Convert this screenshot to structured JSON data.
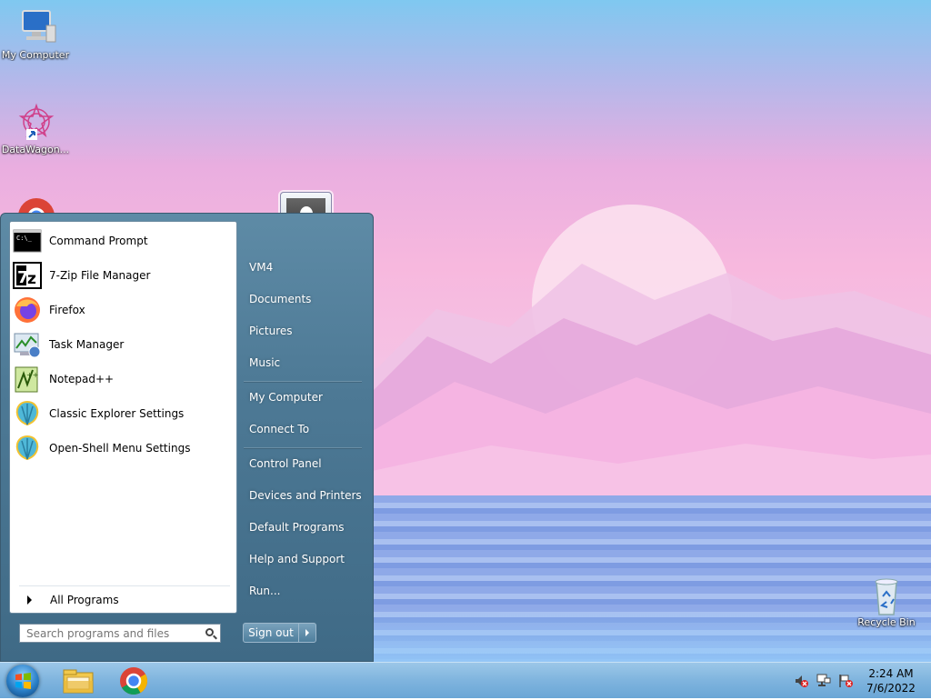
{
  "desktop": {
    "icons": [
      {
        "label": "My Computer",
        "icon": "monitor-icon"
      },
      {
        "label": "DataWagon...",
        "icon": "datawagon-icon"
      },
      {
        "label": "Recycle Bin",
        "icon": "recycle-bin-icon"
      }
    ]
  },
  "start_menu": {
    "programs": [
      {
        "label": "Command Prompt",
        "icon": "command-prompt-icon"
      },
      {
        "label": "7-Zip File Manager",
        "icon": "7zip-icon"
      },
      {
        "label": "Firefox",
        "icon": "firefox-icon"
      },
      {
        "label": "Task Manager",
        "icon": "task-manager-icon"
      },
      {
        "label": "Notepad++",
        "icon": "notepadpp-icon"
      },
      {
        "label": "Classic Explorer Settings",
        "icon": "shell-icon"
      },
      {
        "label": "Open-Shell Menu Settings",
        "icon": "shell-icon"
      }
    ],
    "all_programs": "All Programs",
    "search": {
      "placeholder": "Search programs and files",
      "value": ""
    },
    "right_items": [
      {
        "label": "VM4"
      },
      {
        "label": "Documents"
      },
      {
        "label": "Pictures"
      },
      {
        "label": "Music"
      },
      {
        "label": "My Computer"
      },
      {
        "label": "Connect To"
      },
      {
        "label": "Control Panel"
      },
      {
        "label": "Devices and Printers"
      },
      {
        "label": "Default Programs"
      },
      {
        "label": "Help and Support"
      },
      {
        "label": "Run..."
      }
    ],
    "sign_out": "Sign out"
  },
  "taskbar": {
    "pinned": [
      {
        "icon": "file-explorer-icon"
      },
      {
        "icon": "chrome-icon"
      }
    ],
    "tray_icons": [
      "volume-muted-icon",
      "network-icon",
      "action-center-flag-icon"
    ],
    "clock": {
      "time": "2:24 AM",
      "date": "7/6/2022"
    }
  }
}
